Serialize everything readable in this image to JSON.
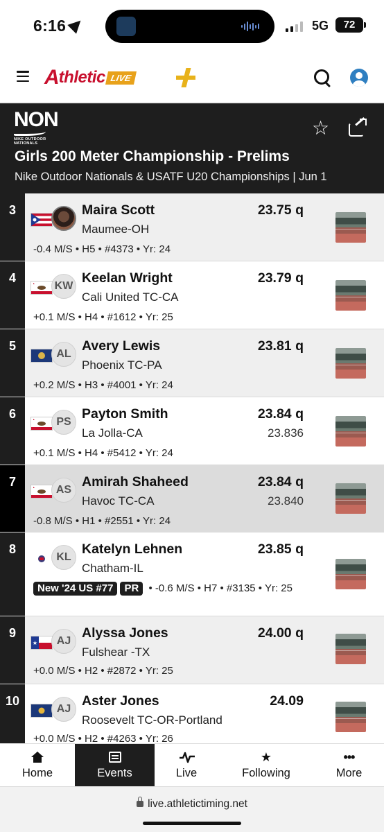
{
  "status_bar": {
    "time": "6:16",
    "network": "5G",
    "battery": "72"
  },
  "app": {
    "logo_main": "thletic",
    "logo_a": "A",
    "logo_live": "LIVE"
  },
  "event": {
    "brand": "NON",
    "brand_sub_line1": "NIKE OUTDOOR",
    "brand_sub_line2": "NATIONALS",
    "title": "Girls 200 Meter Championship - Prelims",
    "subtitle": "Nike Outdoor Nationals & USATF U20 Championships | Jun 1"
  },
  "results": [
    {
      "place": "3",
      "flag": "ohio",
      "initials": "",
      "photo": true,
      "name": "Maira Scott",
      "team": "Maumee-OH",
      "mark": "23.75 q",
      "mark2": "",
      "meta": "-0.4 M/S • H5 • #4373 • Yr: 24",
      "tags": []
    },
    {
      "place": "4",
      "flag": "california",
      "initials": "KW",
      "photo": false,
      "name": "Keelan Wright",
      "team": "Cali United TC-CA",
      "mark": "23.79 q",
      "mark2": "",
      "meta": "+0.1 M/S • H4 • #1612 • Yr: 25",
      "tags": []
    },
    {
      "place": "5",
      "flag": "pennsylvania",
      "initials": "AL",
      "photo": false,
      "name": "Avery Lewis",
      "team": "Phoenix TC-PA",
      "mark": "23.81 q",
      "mark2": "",
      "meta": "+0.2 M/S • H3 • #4001 • Yr: 24",
      "tags": []
    },
    {
      "place": "6",
      "flag": "california",
      "initials": "PS",
      "photo": false,
      "name": "Payton Smith",
      "team": "La Jolla-CA",
      "mark": "23.84 q",
      "mark2": "23.836",
      "meta": "+0.1 M/S • H4 • #5412 • Yr: 24",
      "tags": []
    },
    {
      "place": "7",
      "flag": "california",
      "initials": "AS",
      "photo": false,
      "name": "Amirah Shaheed",
      "team": "Havoc TC-CA",
      "mark": "23.84 q",
      "mark2": "23.840",
      "meta": "-0.8 M/S • H1 • #2551 • Yr: 24",
      "tags": []
    },
    {
      "place": "8",
      "flag": "illinois",
      "initials": "KL",
      "photo": false,
      "name": "Katelyn Lehnen",
      "team": "Chatham-IL",
      "mark": "23.85 q",
      "mark2": "",
      "meta": "",
      "tags": [
        "New '24 US #77",
        "PR"
      ],
      "tags_meta": "• -0.6 M/S • H7 • #3135 • Yr: 25"
    },
    {
      "place": "9",
      "flag": "texas",
      "initials": "AJ",
      "photo": false,
      "name": "Alyssa Jones",
      "team": "Fulshear -TX",
      "mark": "24.00 q",
      "mark2": "",
      "meta": "+0.0 M/S • H2 • #2872 • Yr: 25",
      "tags": []
    },
    {
      "place": "10",
      "flag": "oregon",
      "initials": "AJ",
      "photo": false,
      "name": "Aster Jones",
      "team": "Roosevelt TC-OR-Portland",
      "mark": "24.09",
      "mark2": "",
      "meta": "+0.0 M/S • H2 • #4263 • Yr: 26",
      "tags": []
    }
  ],
  "nav": [
    {
      "label": "Home",
      "icon": "home-icon"
    },
    {
      "label": "Events",
      "icon": "events-list-icon"
    },
    {
      "label": "Live",
      "icon": "live-pulse-icon"
    },
    {
      "label": "Following",
      "icon": "star-icon"
    },
    {
      "label": "More",
      "icon": "more-dots-icon"
    }
  ],
  "url": "live.athletictiming.net",
  "colors": {
    "brand_red": "#c8102e",
    "brand_gold": "#e8a21b",
    "dark": "#1e1e1e"
  }
}
